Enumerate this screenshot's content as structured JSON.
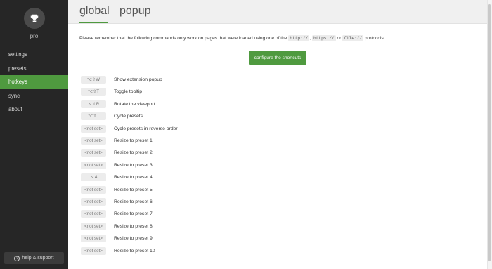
{
  "sidebar": {
    "plan_label": "pro",
    "trophy_icon": "trophy-icon",
    "items": [
      {
        "label": "settings",
        "active": false
      },
      {
        "label": "presets",
        "active": false
      },
      {
        "label": "hotkeys",
        "active": true
      },
      {
        "label": "sync",
        "active": false
      },
      {
        "label": "about",
        "active": false
      }
    ],
    "help_label": "help & support"
  },
  "tabs": [
    {
      "label": "global",
      "active": true
    },
    {
      "label": "popup",
      "active": false
    }
  ],
  "note": {
    "before": "Please remember that the following commands only work on pages that were loaded using one of the ",
    "protocols": [
      "http://",
      "https://",
      "file://"
    ],
    "sep1": ", ",
    "sep2": " or ",
    "after": " protocols."
  },
  "configure_button": "configure the shortcuts",
  "hotkeys": [
    {
      "key": "⌥⇧W",
      "desc": "Show extension popup"
    },
    {
      "key": "⌥⇧T",
      "desc": "Toggle tooltip"
    },
    {
      "key": "⌥⇧R",
      "desc": "Rotate the viewport"
    },
    {
      "key": "⌥⇧↓",
      "desc": "Cycle presets"
    },
    {
      "key": "<not set>",
      "desc": "Cycle presets in reverse order"
    },
    {
      "key": "<not set>",
      "desc": "Resize to preset 1"
    },
    {
      "key": "<not set>",
      "desc": "Resize to preset 2"
    },
    {
      "key": "<not set>",
      "desc": "Resize to preset 3"
    },
    {
      "key": "⌥4",
      "desc": "Resize to preset 4"
    },
    {
      "key": "<not set>",
      "desc": "Resize to preset 5"
    },
    {
      "key": "<not set>",
      "desc": "Resize to preset 6"
    },
    {
      "key": "<not set>",
      "desc": "Resize to preset 7"
    },
    {
      "key": "<not set>",
      "desc": "Resize to preset 8"
    },
    {
      "key": "<not set>",
      "desc": "Resize to preset 9"
    },
    {
      "key": "<not set>",
      "desc": "Resize to preset 10"
    }
  ],
  "colors": {
    "accent": "#4f9a3f",
    "sidebar_bg": "#262626",
    "header_bg": "#f0f0f0"
  }
}
